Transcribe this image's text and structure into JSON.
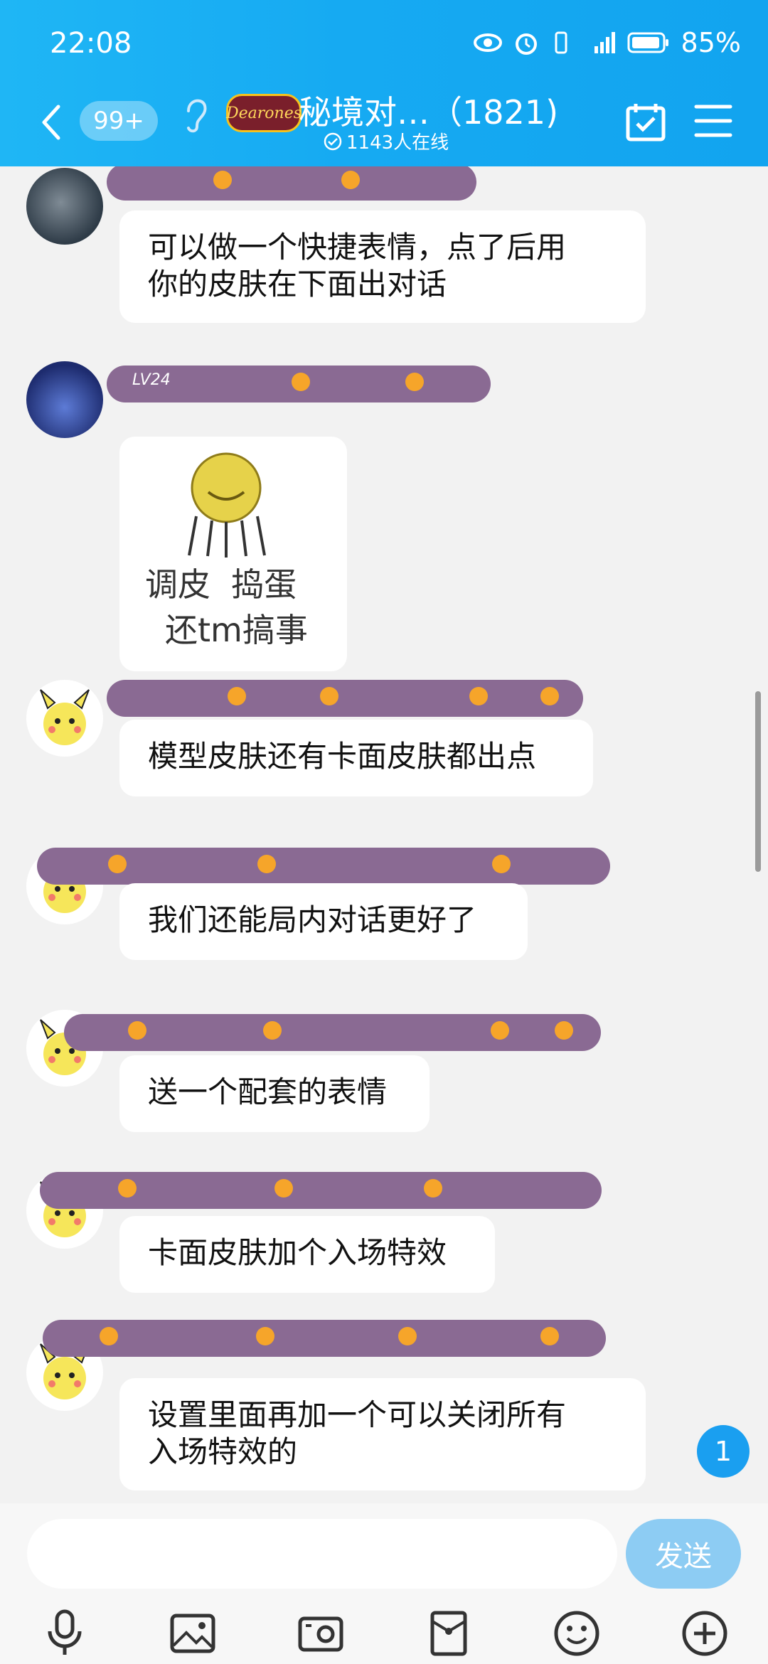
{
  "status": {
    "time": "22:08",
    "battery": "85%"
  },
  "header": {
    "badge": "99+",
    "logo_text": "Dearones",
    "title": "秘境对…（1821)",
    "online": "1143人在线"
  },
  "messages": [
    {
      "text": "可以做一个快捷表情，点了后用\n你的皮肤在下面出对话"
    },
    {
      "level": "LV24",
      "sticker_line1": "调皮  捣蛋",
      "sticker_line2": "还tm搞事"
    },
    {
      "text": "模型皮肤还有卡面皮肤都出点"
    },
    {
      "text": "我们还能局内对话更好了"
    },
    {
      "text": "送一个配套的表情"
    },
    {
      "text": "卡面皮肤加个入场特效"
    },
    {
      "text": "设置里面再加一个可以关闭所有\n入场特效的"
    }
  ],
  "unread_count": "1",
  "composer": {
    "placeholder": "",
    "send_label": "发送"
  },
  "toolbar": [
    "microphone-icon",
    "photo-icon",
    "camera-icon",
    "red-packet-icon",
    "emoji-icon",
    "plus-icon"
  ],
  "colors": {
    "header": "#12a4ef",
    "bubble": "#ffffff",
    "send": "#8dccf3",
    "unread": "#1a9ff0"
  }
}
